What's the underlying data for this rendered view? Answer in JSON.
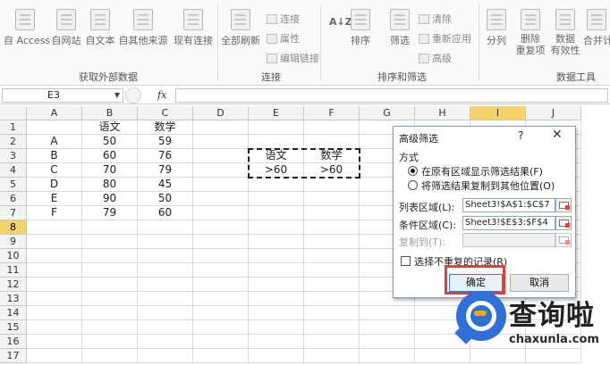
{
  "ribbon": {
    "buttons": {
      "from_access": "自 Access",
      "from_web": "自网站",
      "from_text": "自文本",
      "from_other": "自其他来源",
      "existing": "现有连接",
      "refresh_all": "全部刷新",
      "connections": "连接",
      "properties": "属性",
      "edit_links": "编辑链接",
      "sort": "排序",
      "filter": "筛选",
      "clear": "清除",
      "reapply": "重新应用",
      "advanced": "高级",
      "split": "分列",
      "remove_dup_1": "删除",
      "remove_dup_2": "重复项",
      "validation_1": "数据",
      "validation_2": "有效性",
      "consolidate": "合并计",
      "sort_az_1": "A",
      "sort_az_2": "Z"
    },
    "groups": {
      "get_external": "获取外部数据",
      "connections": "连接",
      "sort_filter": "排序和筛选",
      "data_tools": "数据工具"
    }
  },
  "formula_bar": {
    "name_box": "E3",
    "fx": "fx",
    "formula": ""
  },
  "grid": {
    "columns": [
      "A",
      "B",
      "C",
      "D",
      "E",
      "F",
      "G",
      "H",
      "I",
      "J"
    ],
    "rows": [
      "1",
      "2",
      "3",
      "4",
      "5",
      "6",
      "7",
      "8",
      "9",
      "10",
      "11",
      "12",
      "13",
      "14",
      "15",
      "16",
      "17"
    ],
    "cells": {
      "B1": "语文",
      "C1": "数学",
      "A2": "A",
      "B2": "50",
      "C2": "59",
      "A3": "B",
      "B3": "60",
      "C3": "76",
      "A4": "C",
      "B4": "70",
      "C4": "79",
      "A5": "D",
      "B5": "80",
      "C5": "45",
      "A6": "E",
      "B6": "90",
      "C6": "50",
      "A7": "F",
      "B7": "79",
      "C7": "60",
      "E3": "语文",
      "F3": "数学",
      "E4": ">60",
      "F4": ">60"
    }
  },
  "dialog": {
    "title": "高级筛选",
    "help": "?",
    "close": "✕",
    "method_label": "方式",
    "option_inplace": "在原有区域显示筛选结果(F)",
    "option_copy": "将筛选结果复制到其他位置(O)",
    "list_range_label": "列表区域(L):",
    "list_range_value": "Sheet3!$A$1:$C$7",
    "criteria_label": "条件区域(C):",
    "criteria_value": "Sheet3!$E$3:$F$4",
    "copy_to_label": "复制到(T):",
    "copy_to_value": "",
    "unique_label": "选择不重复的记录(R)",
    "ok": "确定",
    "cancel": "取消"
  },
  "watermark": {
    "name": "查询啦",
    "url": "chaxunla.com"
  }
}
